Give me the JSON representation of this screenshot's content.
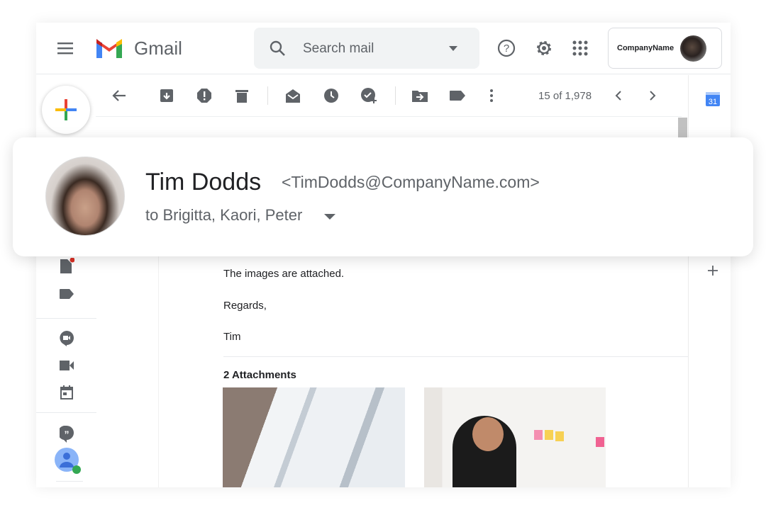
{
  "header": {
    "app_name": "Gmail",
    "search_placeholder": "Search mail",
    "account_name": "CompanyName"
  },
  "toolbar": {
    "pagination": "15 of 1,978"
  },
  "sender_card": {
    "name": "Tim Dodds",
    "email": "<TimDodds@CompanyName.com>",
    "recipients": "to Brigitta, Kaori, Peter"
  },
  "message": {
    "lines": [
      "The images are attached.",
      "Regards,",
      "Tim"
    ],
    "attachments_label": "2 Attachments"
  },
  "colors": {
    "google_blue": "#4285f4",
    "google_red": "#ea4335",
    "google_yellow": "#fbbc04",
    "google_green": "#34a853",
    "icon_gray": "#5f6368"
  }
}
